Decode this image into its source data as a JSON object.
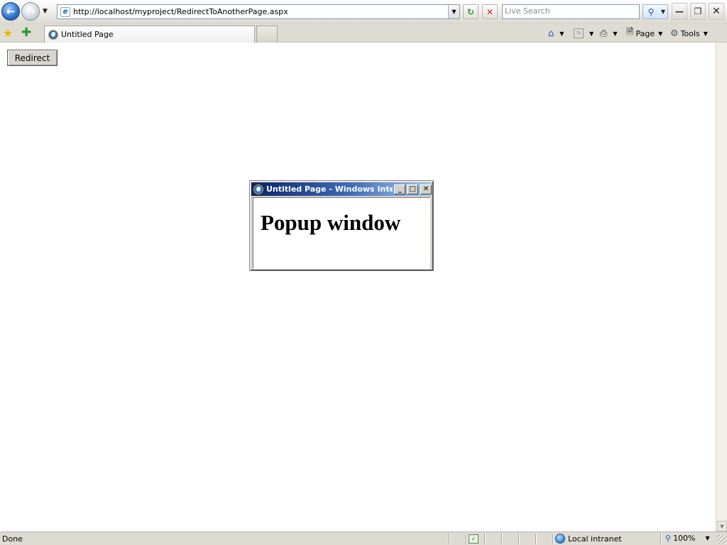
{
  "browser": {
    "url": "http://localhost/myproject/RedirectToAnotherPage.aspx",
    "search_placeholder": "Live Search",
    "tab_title": "Untitled Page",
    "command_bar": {
      "page_label": "Page",
      "tools_label": "Tools"
    },
    "status_bar": {
      "status": "Done",
      "zone": "Local intranet",
      "zoom": "100%"
    }
  },
  "page": {
    "redirect_button": "Redirect"
  },
  "popup": {
    "title": "Untitled Page - Windows Inter...",
    "heading": "Popup window"
  },
  "icons": {
    "back": "back-arrow-icon",
    "forward": "forward-arrow-icon",
    "refresh": "refresh-icon",
    "stop": "stop-icon",
    "search": "magnifier-icon",
    "favorites": "star-icon",
    "add_favorite": "add-favorite-icon",
    "home": "home-icon",
    "feeds": "rss-feed-icon",
    "print": "printer-icon",
    "page": "page-icon",
    "tools": "gear-icon",
    "zone": "globe-icon",
    "zoom": "zoom-icon"
  }
}
